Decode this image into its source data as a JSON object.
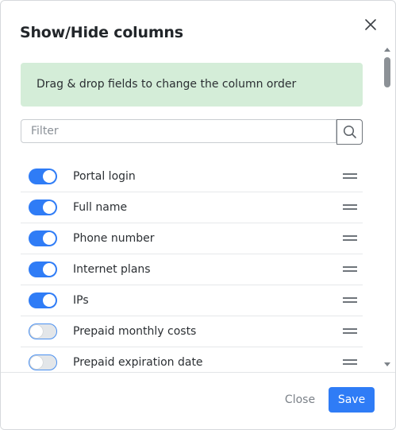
{
  "dialog": {
    "title": "Show/Hide columns",
    "info_text": "Drag & drop fields to change the column order",
    "filter_placeholder": "Filter",
    "filter_value": ""
  },
  "columns": [
    {
      "label": "Portal login",
      "enabled": true
    },
    {
      "label": "Full name",
      "enabled": true
    },
    {
      "label": "Phone number",
      "enabled": true
    },
    {
      "label": "Internet plans",
      "enabled": true
    },
    {
      "label": "IPs",
      "enabled": true
    },
    {
      "label": "Prepaid monthly costs",
      "enabled": false
    },
    {
      "label": "Prepaid expiration date",
      "enabled": false
    }
  ],
  "footer": {
    "close_label": "Close",
    "save_label": "Save"
  },
  "colors": {
    "accent": "#2f7cf6",
    "info_bg": "#d4edd8",
    "toggle_off": "#e3e6e9"
  },
  "icons": {
    "close": "close-icon",
    "search": "search-icon",
    "drag": "drag-handle-icon"
  }
}
